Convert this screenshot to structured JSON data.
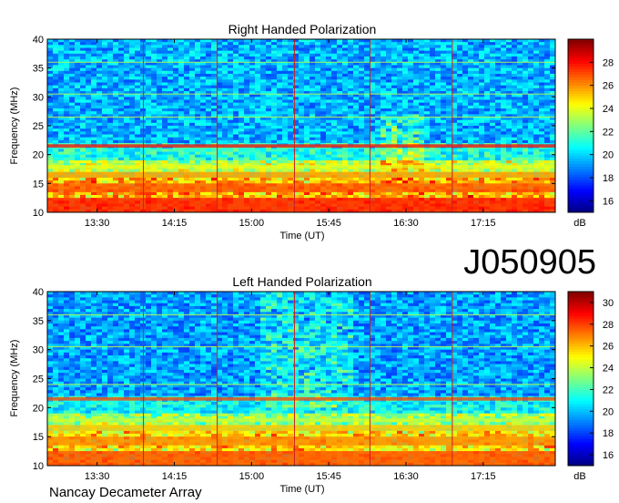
{
  "figure": {
    "id_label": "J050905",
    "footer": "Nancay Decameter Array"
  },
  "chart_data": [
    {
      "type": "heatmap",
      "title": "Right Handed Polarization",
      "xlabel": "Time (UT)",
      "ylabel": "Frequency (MHz)",
      "x_ticks": [
        "13:30",
        "14:15",
        "15:00",
        "15:45",
        "16:30",
        "17:15"
      ],
      "x_tick_minutes": [
        810,
        855,
        900,
        945,
        990,
        1035
      ],
      "xlim_minutes": [
        781,
        1077
      ],
      "ylim": [
        10,
        40
      ],
      "y_ticks": [
        10,
        15,
        20,
        25,
        30,
        35,
        40
      ],
      "colorbar": {
        "label": "dB",
        "min": 15,
        "max": 30,
        "ticks": [
          16,
          18,
          20,
          22,
          24,
          26,
          28
        ]
      },
      "vertical_markers_minutes": [
        837,
        880,
        925,
        969,
        1017
      ],
      "marker_color": "#cc2020",
      "strong_bands_mhz": [
        [
          10,
          12.5,
          28
        ],
        [
          13.5,
          15,
          27
        ],
        [
          16,
          17,
          26
        ],
        [
          17.6,
          18.2,
          24
        ],
        [
          21.2,
          21.8,
          28
        ]
      ],
      "weak_lines_mhz": [
        36,
        30.5,
        26.5
      ]
    },
    {
      "type": "heatmap",
      "title": "Left Handed Polarization",
      "xlabel": "Time (UT)",
      "ylabel": "Frequency (MHz)",
      "x_ticks": [
        "13:30",
        "14:15",
        "15:00",
        "15:45",
        "16:30",
        "17:15"
      ],
      "x_tick_minutes": [
        810,
        855,
        900,
        945,
        990,
        1035
      ],
      "xlim_minutes": [
        781,
        1077
      ],
      "ylim": [
        10,
        40
      ],
      "y_ticks": [
        10,
        15,
        20,
        25,
        30,
        35,
        40
      ],
      "colorbar": {
        "label": "dB",
        "min": 15,
        "max": 31,
        "ticks": [
          16,
          18,
          20,
          22,
          24,
          26,
          28,
          30
        ]
      },
      "vertical_markers_minutes": [
        837,
        880,
        925,
        969,
        1017
      ],
      "marker_color": "#cc2020",
      "strong_bands_mhz": [
        [
          10,
          12.5,
          28
        ],
        [
          13.5,
          15,
          27
        ],
        [
          16,
          17,
          26
        ],
        [
          17.6,
          18.2,
          24
        ],
        [
          21.2,
          21.8,
          28
        ]
      ],
      "weak_lines_mhz": [
        36,
        30.5,
        24
      ]
    }
  ]
}
